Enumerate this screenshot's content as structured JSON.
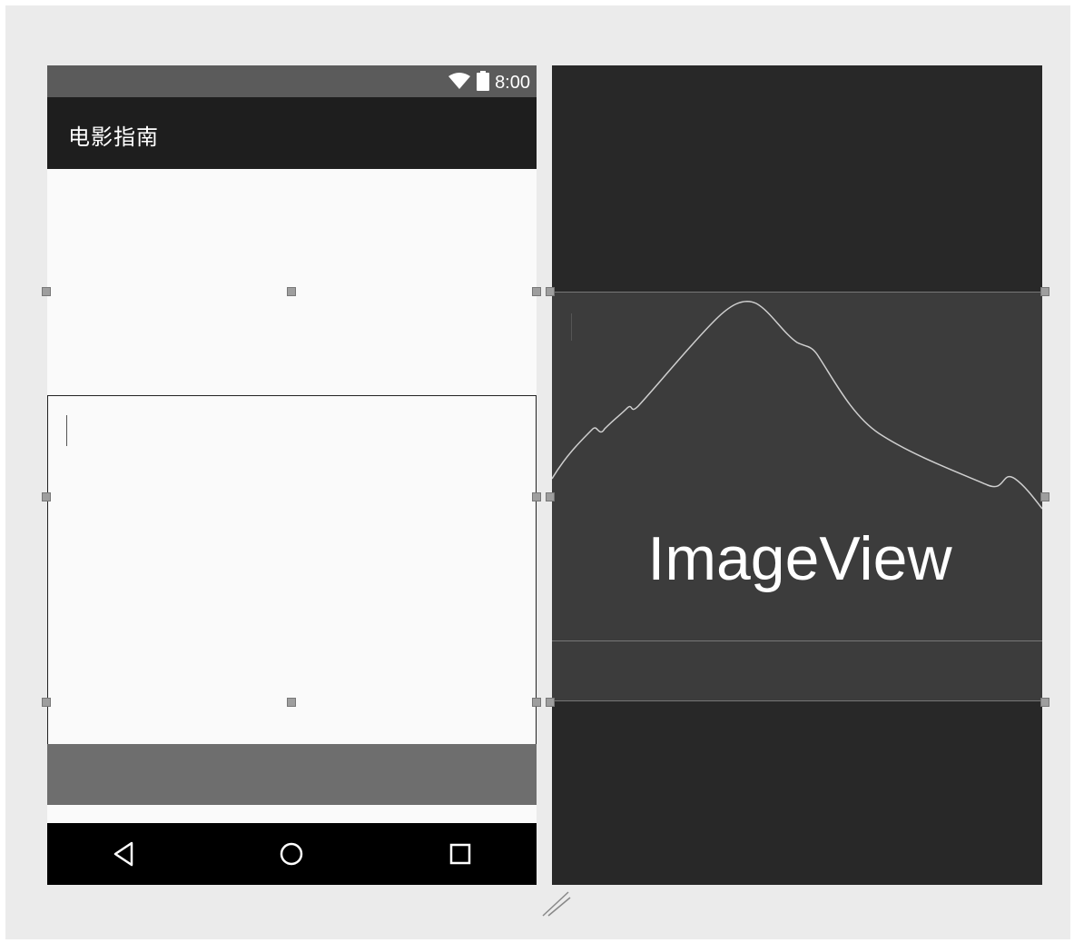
{
  "status_bar": {
    "time": "8:00",
    "icons": [
      "wifi-icon",
      "battery-icon"
    ]
  },
  "app_bar": {
    "title": "电影指南"
  },
  "navigation_bar": {
    "buttons": [
      "back-icon",
      "home-icon",
      "recents-icon"
    ]
  },
  "blueprint": {
    "image_view_label": "ImageView"
  },
  "colors": {
    "status_bar": "#5b5b5b",
    "app_bar": "#1e1e1e",
    "caption_bar": "#6e6e6e",
    "blueprint_bg": "#282828",
    "blueprint_widget": "#3c3c3c"
  }
}
